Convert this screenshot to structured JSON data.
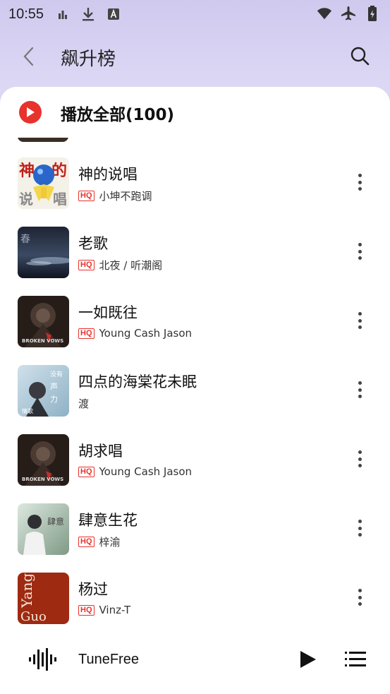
{
  "status_bar": {
    "time": "10:55",
    "left_icons": [
      "signal-bars-icon",
      "download-icon",
      "a-icon"
    ],
    "right_icons": [
      "wifi-icon",
      "airplane-icon",
      "battery-icon"
    ]
  },
  "header": {
    "title": "飙升榜"
  },
  "play_all": {
    "label": "播放全部(100)"
  },
  "songs": [
    {
      "title": "神的说唱",
      "artist": "小坤不跑调",
      "hq": "HQ",
      "cover": "cover-shen"
    },
    {
      "title": "老歌",
      "artist": "北夜 / 听潮阁",
      "hq": "HQ",
      "cover": "cover-laoge"
    },
    {
      "title": "一如既往",
      "artist": "Young Cash Jason",
      "hq": "HQ",
      "cover": "cover-broken-vows"
    },
    {
      "title": "四点的海棠花未眠",
      "artist": "渡",
      "hq": "",
      "cover": "cover-sidian"
    },
    {
      "title": "胡求唱",
      "artist": "Young Cash Jason",
      "hq": "HQ",
      "cover": "cover-broken-vows"
    },
    {
      "title": "肆意生花",
      "artist": "梓渝",
      "hq": "HQ",
      "cover": "cover-siyi"
    },
    {
      "title": "杨过",
      "artist": "Vinz-T",
      "hq": "HQ",
      "cover": "cover-yangguo"
    }
  ],
  "mini_player": {
    "title": "TuneFree"
  },
  "colors": {
    "accent": "#e8322d",
    "header_bg": "#d6d1f2"
  }
}
